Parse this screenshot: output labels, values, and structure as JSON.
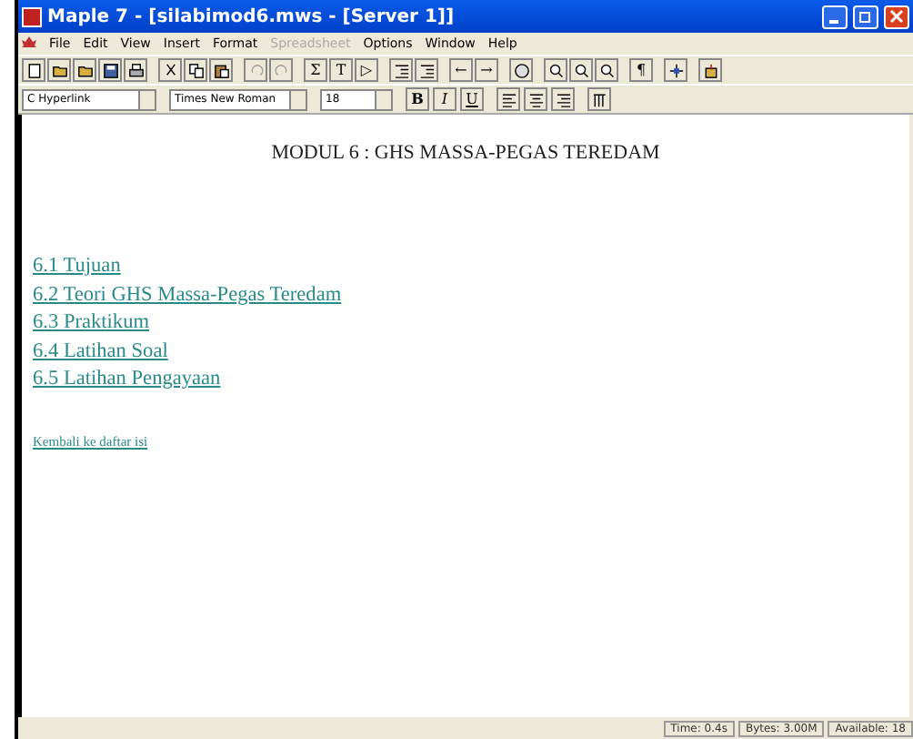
{
  "window": {
    "title": "Maple 7  - [silabimod6.mws - [Server 1]]"
  },
  "menu": [
    {
      "label": "File",
      "disabled": false
    },
    {
      "label": "Edit",
      "disabled": false
    },
    {
      "label": "View",
      "disabled": false
    },
    {
      "label": "Insert",
      "disabled": false
    },
    {
      "label": "Format",
      "disabled": false
    },
    {
      "label": "Spreadsheet",
      "disabled": true
    },
    {
      "label": "Options",
      "disabled": false
    },
    {
      "label": "Window",
      "disabled": false
    },
    {
      "label": "Help",
      "disabled": false
    }
  ],
  "toolbar": [
    {
      "kind": "icon"
    },
    {
      "kind": "icon"
    },
    {
      "kind": "icon"
    },
    {
      "kind": "icon"
    },
    {
      "kind": "icon"
    },
    {
      "kind": "icon"
    },
    {
      "kind": "icon"
    },
    {
      "kind": "icon"
    },
    {
      "kind": "icon"
    },
    {
      "kind": "icon"
    },
    {
      "kind": "glyph",
      "text": "Σ"
    },
    {
      "kind": "glyph",
      "text": "T"
    },
    {
      "kind": "glyph",
      "text": "▷"
    },
    {
      "kind": "icon"
    },
    {
      "kind": "icon"
    },
    {
      "kind": "glyph",
      "text": "←"
    },
    {
      "kind": "glyph",
      "text": "→"
    },
    {
      "kind": "icon"
    },
    {
      "kind": "icon"
    },
    {
      "kind": "icon"
    },
    {
      "kind": "icon"
    },
    {
      "kind": "glyph",
      "text": "¶"
    },
    {
      "kind": "icon"
    },
    {
      "kind": "icon"
    }
  ],
  "format_bar": {
    "style": "C Hyperlink",
    "font": "Times New Roman",
    "size": "18",
    "buttons": [
      {
        "kind": "glyph",
        "text": "B"
      },
      {
        "kind": "glyph",
        "text": "I"
      },
      {
        "kind": "glyph",
        "text": "U"
      },
      {
        "kind": "icon"
      },
      {
        "kind": "icon"
      },
      {
        "kind": "icon"
      },
      {
        "kind": "icon"
      }
    ]
  },
  "document": {
    "heading": "MODUL 6 : GHS MASSA-PEGAS TEREDAM",
    "links": [
      "6.1 Tujuan ",
      "6.2 Teori GHS Massa-Pegas Teredam",
      "6.3 Praktikum",
      "6.4 Latihan Soal",
      "6.5 Latihan Pengayaan"
    ],
    "back_link": "Kembali ke daftar isi "
  },
  "status_bar": [
    "Time: 0.4s",
    "Bytes: 3.00M",
    "Available: 18"
  ]
}
